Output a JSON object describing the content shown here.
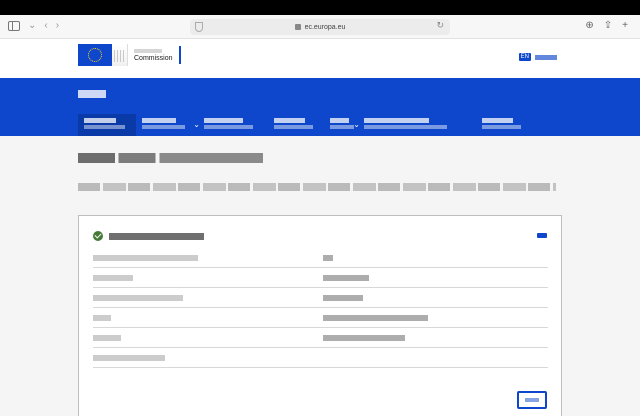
{
  "browser": {
    "url": "ec.europa.eu"
  },
  "header": {
    "logo_name": "Commission",
    "language_code": "EN"
  },
  "colors": {
    "brand_blue": "#0e47cb",
    "success_green": "#467a39",
    "background": "#f5f5f5"
  },
  "nav": {
    "items": [
      {
        "label": "",
        "has_dropdown": false,
        "active": true
      },
      {
        "label": "",
        "has_dropdown": true,
        "active": false
      },
      {
        "label": "",
        "has_dropdown": false,
        "active": false
      },
      {
        "label": "",
        "has_dropdown": false,
        "active": false
      },
      {
        "label": "",
        "has_dropdown": true,
        "active": false
      },
      {
        "label": "",
        "has_dropdown": false,
        "active": false
      },
      {
        "label": "",
        "has_dropdown": false,
        "active": false
      }
    ]
  },
  "result": {
    "rows": [
      {
        "key": "",
        "value": ""
      },
      {
        "key": "",
        "value": ""
      },
      {
        "key": "",
        "value": ""
      },
      {
        "key": "",
        "value": ""
      },
      {
        "key": "",
        "value": ""
      },
      {
        "key": "",
        "value": ""
      }
    ]
  }
}
